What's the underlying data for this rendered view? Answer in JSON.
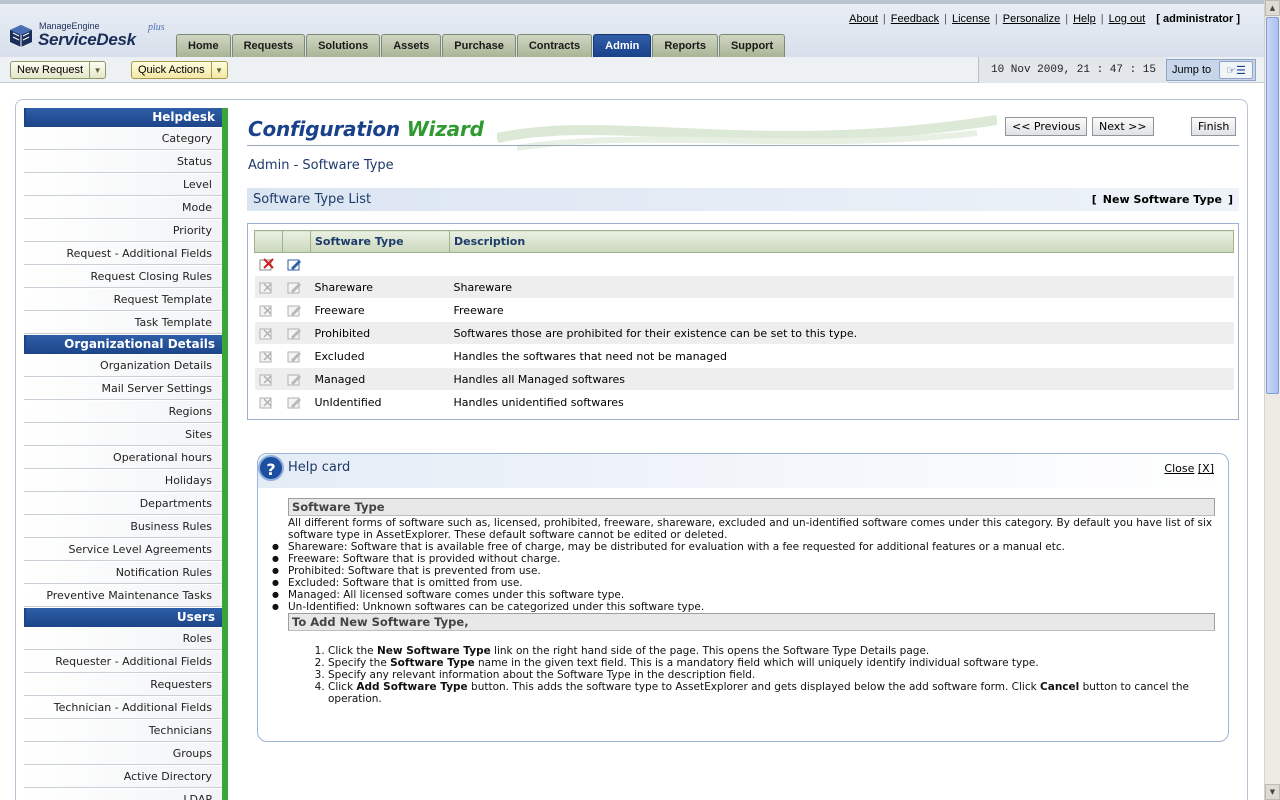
{
  "header": {
    "brand_top": "ManageEngine",
    "brand_main": "ServiceDesk",
    "brand_sup": "plus",
    "links": [
      "About",
      "Feedback",
      "License",
      "Personalize",
      "Help",
      "Log out"
    ],
    "user": "[ administrator ]",
    "tabs": [
      "Home",
      "Requests",
      "Solutions",
      "Assets",
      "Purchase",
      "Contracts",
      "Admin",
      "Reports",
      "Support"
    ],
    "active_tab": "Admin",
    "accent_color": "#1a428b"
  },
  "toolbar": {
    "new_request": "New Request",
    "quick_actions": "Quick Actions",
    "datetime": "10 Nov 2009, 21 : 47 : 15",
    "jump_to": "Jump to"
  },
  "leftnav": {
    "sections": [
      {
        "title": "Helpdesk",
        "items": [
          "Category",
          "Status",
          "Level",
          "Mode",
          "Priority",
          "Request - Additional Fields",
          "Request Closing Rules",
          "Request Template",
          "Task Template"
        ]
      },
      {
        "title": "Organizational Details",
        "items": [
          "Organization Details",
          "Mail Server Settings",
          "Regions",
          "Sites",
          "Operational hours",
          "Holidays",
          "Departments",
          "Business Rules",
          "Service Level Agreements",
          "Notification Rules",
          "Preventive Maintenance Tasks"
        ]
      },
      {
        "title": "Users",
        "items": [
          "Roles",
          "Requester - Additional Fields",
          "Requesters",
          "Technician - Additional Fields",
          "Technicians",
          "Groups",
          "Active Directory",
          "LDAP"
        ]
      }
    ]
  },
  "wizard": {
    "title_1": "Configuration",
    "title_2": "Wizard",
    "previous": "<< Previous",
    "next": "Next >>",
    "finish": "Finish"
  },
  "page": {
    "heading": "Admin - Software Type",
    "list_title": "Software Type List",
    "new_link": "New Software Type"
  },
  "table": {
    "columns": [
      "Software Type",
      "Description"
    ],
    "rows": [
      {
        "name": "Shareware",
        "description": "Shareware"
      },
      {
        "name": "Freeware",
        "description": "Freeware"
      },
      {
        "name": "Prohibited",
        "description": "Softwares those are prohibited for their existence can be set to this type."
      },
      {
        "name": "Excluded",
        "description": "Handles the softwares that need not be managed"
      },
      {
        "name": "Managed",
        "description": "Handles all Managed softwares"
      },
      {
        "name": "UnIdentified",
        "description": "Handles unidentified softwares"
      }
    ]
  },
  "help": {
    "title": "Help card",
    "close": "Close",
    "close_x": "[X]",
    "section1_title": "Software Type",
    "intro": "All different forms of software such as, licensed, prohibited, freeware, shareware, excluded and un-identified software comes under this category. By default you have list of six software type in AssetExplorer. These default software cannot be edited or deleted.",
    "bullets": [
      "Shareware: Software that is available free of charge, may be distributed for evaluation with a fee requested for additional features or a manual etc.",
      "Freeware: Software that is provided without charge.",
      "Prohibited: Software that is prevented from use.",
      "Excluded: Software that is omitted from use.",
      "Managed: All licensed software comes under this software type.",
      "Un-Identified: Unknown softwares can be categorized under this software type."
    ],
    "section2_title": "To Add New Software Type,",
    "steps": [
      {
        "pre": "Click the ",
        "bold": "New Software Type",
        "post": " link on the right hand side of the page. This opens the Software Type Details page.",
        "bold2": "",
        "post2": ""
      },
      {
        "pre": "Specify the ",
        "bold": "Software Type",
        "post": " name in the given text field. This is a mandatory field which will uniquely identify individual software type.",
        "bold2": "",
        "post2": ""
      },
      {
        "pre": "Specify any relevant information about the Software Type in the description field.",
        "bold": "",
        "post": "",
        "bold2": "",
        "post2": ""
      },
      {
        "pre": "Click ",
        "bold": "Add Software Type",
        "post": " button. This adds the software type to AssetExplorer and gets displayed below the add software form. Click ",
        "bold2": "Cancel",
        "post2": " button to cancel the operation."
      }
    ]
  }
}
